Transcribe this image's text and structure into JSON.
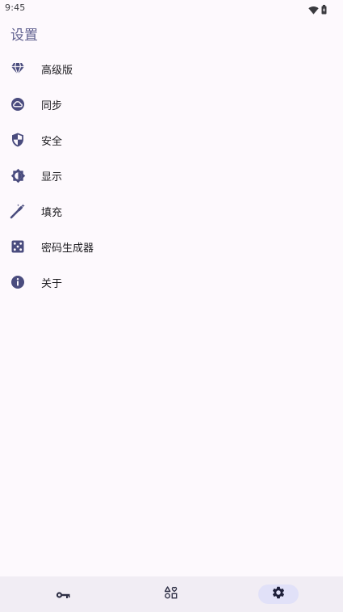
{
  "status_bar": {
    "time": "9:45",
    "icons": [
      "wifi-icon",
      "battery-icon"
    ]
  },
  "page": {
    "title": "设置"
  },
  "menu": {
    "items": [
      {
        "label": "高级版",
        "icon": "diamond-icon"
      },
      {
        "label": "同步",
        "icon": "cloud-sync-icon"
      },
      {
        "label": "安全",
        "icon": "shield-icon"
      },
      {
        "label": "显示",
        "icon": "brightness-icon"
      },
      {
        "label": "填充",
        "icon": "magic-wand-icon"
      },
      {
        "label": "密码生成器",
        "icon": "dice-icon"
      },
      {
        "label": "关于",
        "icon": "info-icon"
      }
    ]
  },
  "bottom_nav": {
    "items": [
      {
        "icon": "key-icon",
        "active": false
      },
      {
        "icon": "shapes-icon",
        "active": false
      },
      {
        "icon": "gear-icon",
        "active": true
      }
    ]
  },
  "colors": {
    "background": "#FDF9FD",
    "accent": "#5E5F8E",
    "icon": "#4A4C7E",
    "nav_background": "#F1EDF4",
    "active_pill": "#E1E1F8"
  }
}
